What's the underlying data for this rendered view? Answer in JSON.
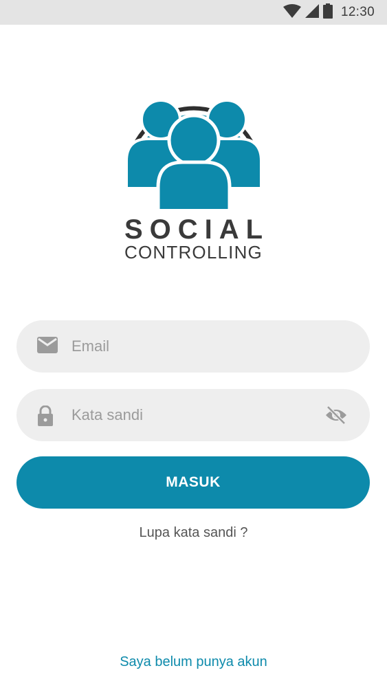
{
  "status_bar": {
    "time": "12:30",
    "icons": [
      "wifi-icon",
      "signal-icon",
      "battery-icon"
    ]
  },
  "brand": {
    "line1": "SOCIAL",
    "line2": "CONTROLLING",
    "logo_icon": "people-broadcast-logo"
  },
  "form": {
    "email": {
      "placeholder": "Email",
      "value": "",
      "icon": "mail-icon"
    },
    "password": {
      "placeholder": "Kata sandi",
      "value": "",
      "icon": "lock-icon",
      "toggle_icon": "eye-off-icon"
    },
    "submit_label": "MASUK",
    "forgot_label": "Lupa kata sandi ?"
  },
  "footer": {
    "register_label": "Saya belum punya akun"
  },
  "colors": {
    "primary": "#0d8aab",
    "status_bar_bg": "#e4e4e4",
    "field_bg": "#eeeeee",
    "text_dark": "#3a3a3a",
    "placeholder": "#9b9b9b"
  }
}
